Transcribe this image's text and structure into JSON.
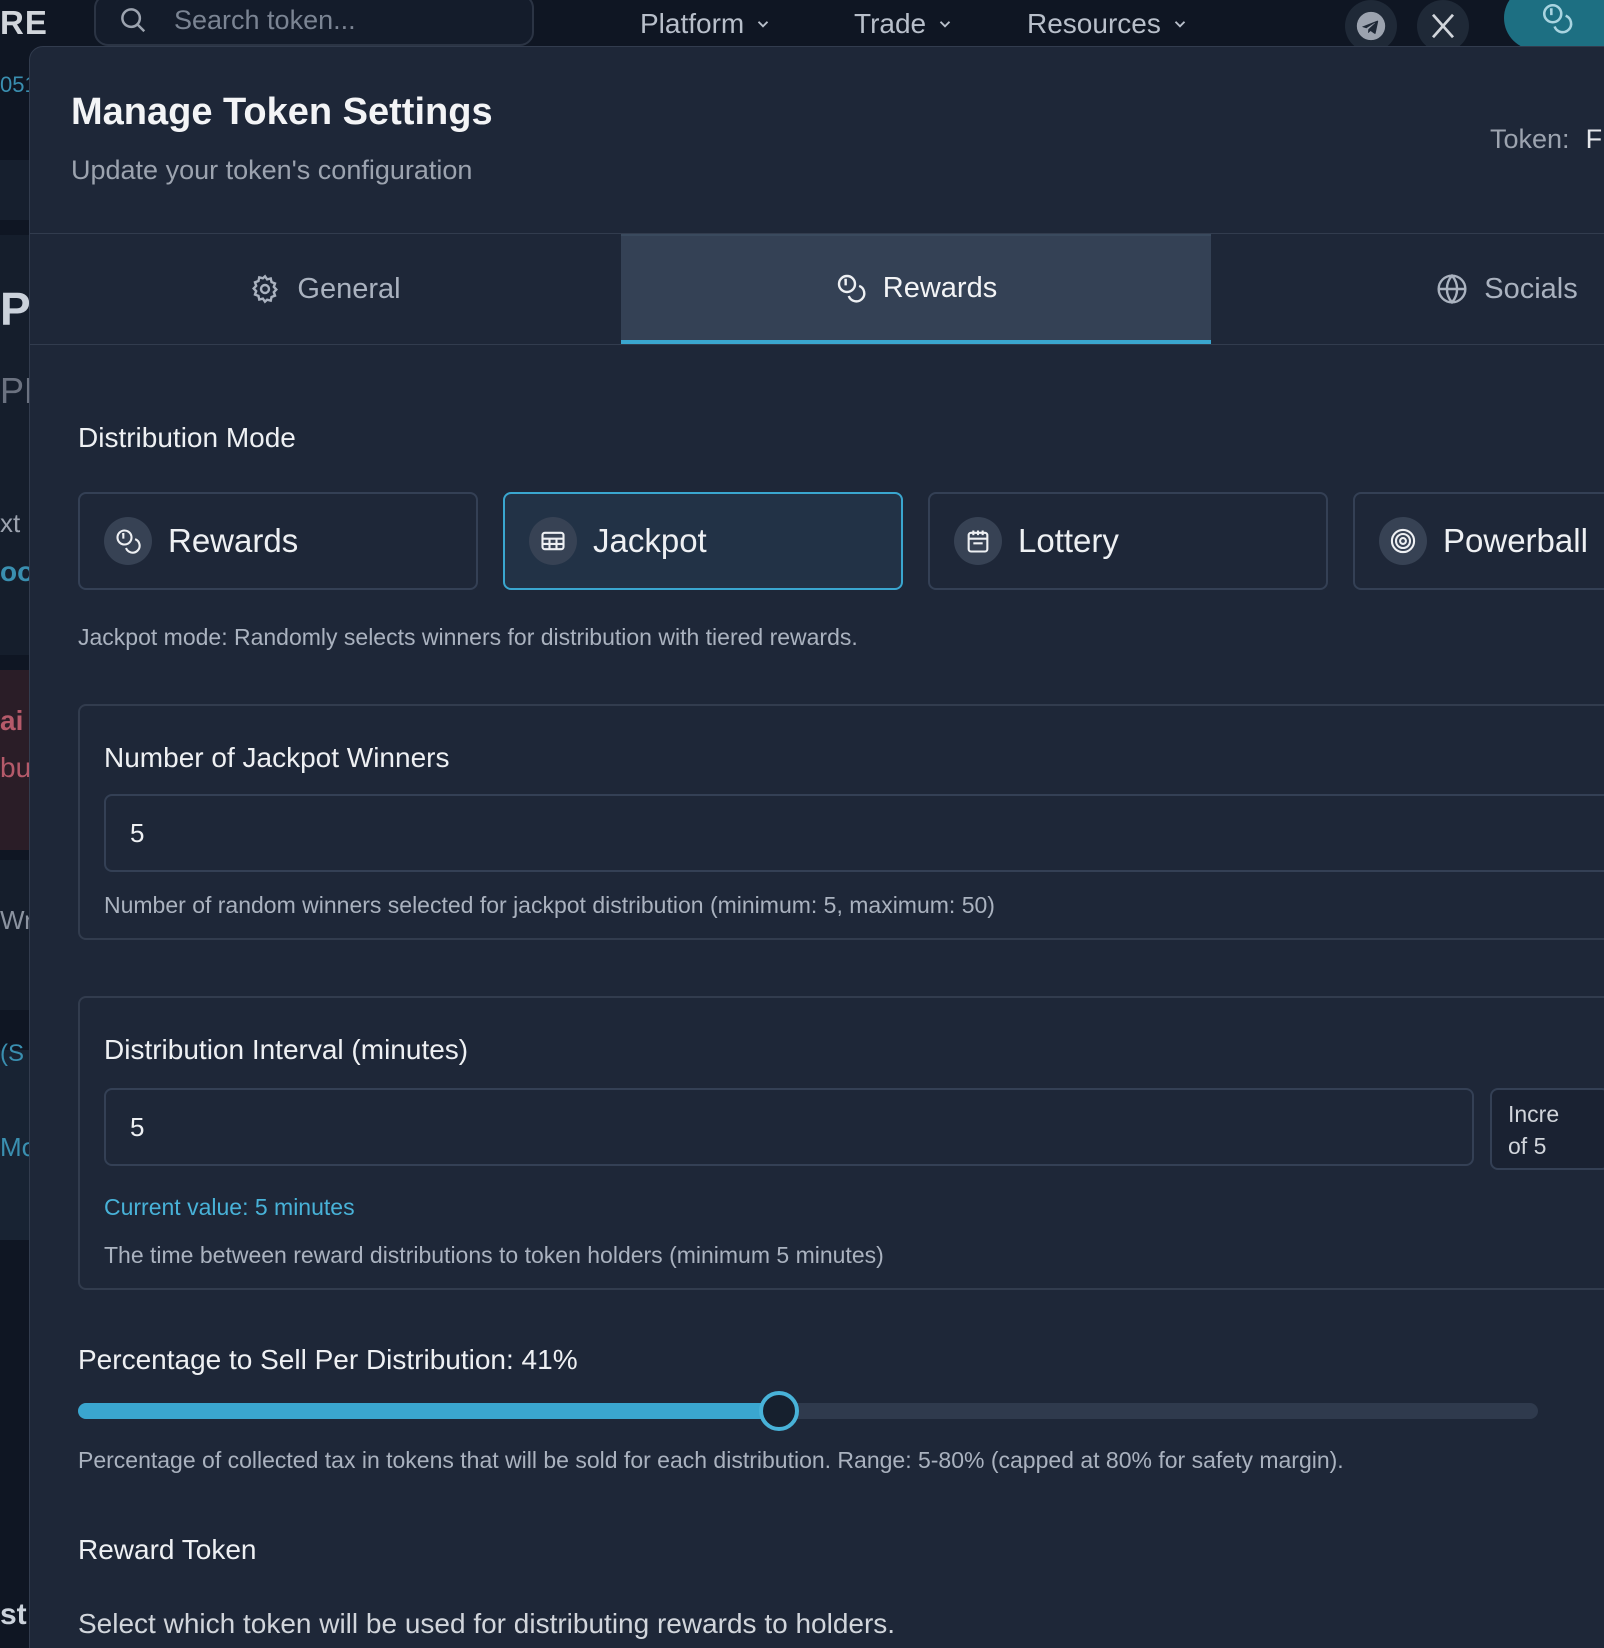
{
  "nav": {
    "brand": "RE",
    "search_placeholder": "Search token...",
    "menus": [
      "Platform",
      "Trade",
      "Resources"
    ],
    "icons": [
      "telegram-icon",
      "x-icon",
      "coins-icon"
    ]
  },
  "background_fragments": [
    "051",
    "P",
    "PL",
    "xt",
    "oo",
    "ai",
    "bu",
    "Wr",
    "(S",
    "Mo",
    "st"
  ],
  "modal": {
    "title": "Manage Token Settings",
    "subtitle": "Update your token's configuration",
    "token_label": "Token:",
    "token_value": "F"
  },
  "tabs": [
    {
      "label": "General",
      "icon": "gear-icon",
      "active": false
    },
    {
      "label": "Rewards",
      "icon": "coins-icon",
      "active": true
    },
    {
      "label": "Socials",
      "icon": "globe-icon",
      "active": false
    }
  ],
  "distribution": {
    "label": "Distribution Mode",
    "modes": [
      {
        "label": "Rewards",
        "icon": "coins-icon",
        "active": false
      },
      {
        "label": "Jackpot",
        "icon": "grid-icon",
        "active": true
      },
      {
        "label": "Lottery",
        "icon": "ticket-icon",
        "active": false
      },
      {
        "label": "Powerball",
        "icon": "target-icon",
        "active": false
      }
    ],
    "description": "Jackpot mode: Randomly selects winners for distribution with tiered rewards."
  },
  "winners": {
    "title": "Number of Jackpot Winners",
    "value": "5",
    "hint": "Number of random winners selected for jackpot distribution (minimum: 5, maximum: 50)"
  },
  "interval": {
    "title": "Distribution Interval (minutes)",
    "value": "5",
    "increment_line1": "Incre",
    "increment_line2": "of 5",
    "current": "Current value: 5 minutes",
    "hint": "The time between reward distributions to token holders (minimum 5 minutes)"
  },
  "sell": {
    "label": "Percentage to Sell Per Distribution: 41%",
    "value_percent": 41,
    "min": 5,
    "max": 80,
    "hint": "Percentage of collected tax in tokens that will be sold for each distribution. Range: 5-80% (capped at 80% for safety margin)."
  },
  "reward_token": {
    "title": "Reward Token",
    "description": "Select which token will be used for distributing rewards to holders."
  },
  "colors": {
    "accent": "#3aa6cf",
    "modal_bg": "#1e2738",
    "page_bg": "#111827"
  }
}
